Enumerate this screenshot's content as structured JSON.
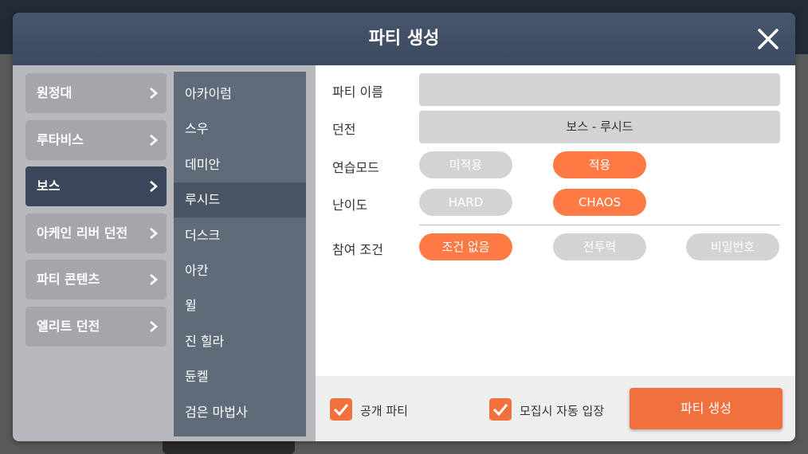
{
  "dialog": {
    "title": "파티 생성"
  },
  "categories": [
    {
      "label": "원정대",
      "active": false
    },
    {
      "label": "루타비스",
      "active": false
    },
    {
      "label": "보스",
      "active": true
    },
    {
      "label": "아케인 리버 던전",
      "active": false
    },
    {
      "label": "파티 콘텐츠",
      "active": false
    },
    {
      "label": "엘리트 던전",
      "active": false
    }
  ],
  "bosses": [
    {
      "label": "아카이럼",
      "active": false
    },
    {
      "label": "스우",
      "active": false
    },
    {
      "label": "데미안",
      "active": false
    },
    {
      "label": "루시드",
      "active": true
    },
    {
      "label": "더스크",
      "active": false
    },
    {
      "label": "아칸",
      "active": false
    },
    {
      "label": "윌",
      "active": false
    },
    {
      "label": "진 힐라",
      "active": false
    },
    {
      "label": "듄켈",
      "active": false
    },
    {
      "label": "검은 마법사",
      "active": false
    }
  ],
  "form": {
    "party_name_label": "파티 이름",
    "party_name_value": "",
    "dungeon_label": "던전",
    "dungeon_value": "보스 - 루시드",
    "practice_label": "연습모드",
    "practice_options": [
      "미적용",
      "적용"
    ],
    "practice_selected": "적용",
    "difficulty_label": "난이도",
    "difficulty_options": [
      "HARD",
      "CHAOS"
    ],
    "difficulty_selected": "CHAOS",
    "condition_label": "참여 조건",
    "condition_options": [
      "조건 없음",
      "전투력",
      "비밀번호"
    ],
    "condition_selected": "조건 없음"
  },
  "footer": {
    "public_party_label": "공개 파티",
    "public_party_checked": true,
    "auto_join_label": "모집시 자동 입장",
    "auto_join_checked": true,
    "create_button_label": "파티 생성"
  },
  "colors": {
    "accent": "#f0703e",
    "header": "#3f4c62",
    "active_category": "#3a4659"
  }
}
